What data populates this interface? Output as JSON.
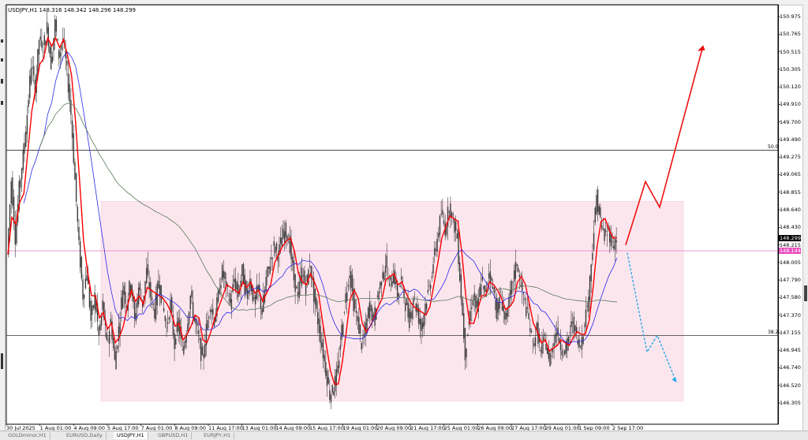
{
  "header": {
    "text": "USDJPY,H1  148.316 148.342 148.296 148.299"
  },
  "chart_data": {
    "type": "candlestick",
    "symbol": "USDJPY",
    "timeframe": "H1",
    "ylim": [
      146.25,
      151.1
    ],
    "price_ticks": [
      "150.975",
      "150.765",
      "150.515",
      "150.305",
      "150.120",
      "149.910",
      "149.700",
      "149.490",
      "149.275",
      "149.065",
      "148.855",
      "148.640",
      "148.430",
      "148.215",
      "148.005",
      "147.790",
      "147.580",
      "147.370",
      "147.155",
      "146.945",
      "146.740",
      "146.520",
      "146.305"
    ],
    "time_ticks": [
      "30 Jul 2025",
      "1 Aug 01:00",
      "4 Aug 09:00",
      "5 Aug 17:00",
      "7 Aug 01:00",
      "8 Aug 09:00",
      "11 Aug 17:00",
      "13 Aug 01:00",
      "14 Aug 09:00",
      "15 Aug 17:00",
      "19 Aug 01:00",
      "20 Aug 09:00",
      "21 Aug 17:00",
      "25 Aug 01:00",
      "26 Aug 09:00",
      "27 Aug 17:00",
      "29 Aug 01:00",
      "1 Sep 09:00",
      "2 Sep 17:00"
    ],
    "current_price": "148.299",
    "current_price_secondary": "148.144",
    "levels": [
      {
        "label": "50.0",
        "price": 149.36
      },
      {
        "label": "38.2",
        "price": 147.12
      }
    ],
    "range_box": {
      "price_high": 148.74,
      "price_low": 146.33
    },
    "price_path": [
      [
        0,
        148.1
      ],
      [
        1,
        149.0
      ],
      [
        2,
        148.3
      ],
      [
        3,
        148.9
      ],
      [
        4,
        149.3
      ],
      [
        5,
        149.8
      ],
      [
        6,
        150.4
      ],
      [
        7,
        150.1
      ],
      [
        8,
        150.7
      ],
      [
        9,
        150.6
      ],
      [
        10,
        150.85
      ],
      [
        11,
        150.4
      ],
      [
        12,
        150.9
      ],
      [
        13,
        150.5
      ],
      [
        14,
        150.7
      ],
      [
        15,
        150.3
      ],
      [
        16,
        149.8
      ],
      [
        17,
        149.0
      ],
      [
        18,
        148.2
      ],
      [
        19,
        147.6
      ],
      [
        20,
        147.9
      ],
      [
        21,
        147.3
      ],
      [
        22,
        147.6
      ],
      [
        23,
        147.1
      ],
      [
        24,
        147.5
      ],
      [
        25,
        147.0
      ],
      [
        26,
        147.3
      ],
      [
        27,
        146.8
      ],
      [
        28,
        147.2
      ],
      [
        29,
        147.7
      ],
      [
        30,
        147.5
      ],
      [
        31,
        147.8
      ],
      [
        32,
        147.3
      ],
      [
        33,
        147.7
      ],
      [
        34,
        147.5
      ],
      [
        35,
        147.9
      ],
      [
        36,
        147.6
      ],
      [
        37,
        147.4
      ],
      [
        38,
        147.8
      ],
      [
        39,
        147.5
      ],
      [
        40,
        147.2
      ],
      [
        41,
        147.5
      ],
      [
        42,
        147.0
      ],
      [
        43,
        147.3
      ],
      [
        44,
        146.9
      ],
      [
        45,
        147.2
      ],
      [
        46,
        147.6
      ],
      [
        47,
        147.3
      ],
      [
        48,
        147.1
      ],
      [
        49,
        146.8
      ],
      [
        50,
        147.2
      ],
      [
        51,
        147.5
      ],
      [
        52,
        147.3
      ],
      [
        53,
        147.6
      ],
      [
        54,
        147.9
      ],
      [
        55,
        147.7
      ],
      [
        56,
        147.5
      ],
      [
        57,
        147.8
      ],
      [
        58,
        147.6
      ],
      [
        59,
        147.9
      ],
      [
        60,
        147.6
      ],
      [
        61,
        147.8
      ],
      [
        62,
        147.5
      ],
      [
        63,
        147.7
      ],
      [
        64,
        147.4
      ],
      [
        65,
        147.8
      ],
      [
        66,
        148.0
      ],
      [
        67,
        148.2
      ],
      [
        68,
        148.1
      ],
      [
        69,
        148.3
      ],
      [
        70,
        148.4
      ],
      [
        71,
        148.2
      ],
      [
        72,
        147.8
      ],
      [
        73,
        147.6
      ],
      [
        74,
        147.9
      ],
      [
        75,
        147.7
      ],
      [
        76,
        148.0
      ],
      [
        77,
        147.6
      ],
      [
        78,
        147.3
      ],
      [
        79,
        147.0
      ],
      [
        80,
        146.7
      ],
      [
        81,
        146.4
      ],
      [
        82,
        146.5
      ],
      [
        83,
        146.7
      ],
      [
        84,
        147.2
      ],
      [
        85,
        147.6
      ],
      [
        86,
        147.9
      ],
      [
        87,
        147.5
      ],
      [
        88,
        147.3
      ],
      [
        89,
        147.0
      ],
      [
        90,
        147.2
      ],
      [
        91,
        147.5
      ],
      [
        92,
        147.3
      ],
      [
        93,
        147.6
      ],
      [
        94,
        147.8
      ],
      [
        95,
        148.0
      ],
      [
        96,
        147.7
      ],
      [
        97,
        147.9
      ],
      [
        98,
        147.6
      ],
      [
        99,
        147.8
      ],
      [
        100,
        147.5
      ],
      [
        101,
        147.3
      ],
      [
        102,
        147.6
      ],
      [
        103,
        147.4
      ],
      [
        104,
        147.2
      ],
      [
        105,
        147.5
      ],
      [
        106,
        147.7
      ],
      [
        107,
        148.0
      ],
      [
        108,
        148.3
      ],
      [
        109,
        148.6
      ],
      [
        110,
        148.4
      ],
      [
        111,
        148.7
      ],
      [
        112,
        148.5
      ],
      [
        113,
        148.3
      ],
      [
        114,
        147.6
      ],
      [
        115,
        146.9
      ],
      [
        116,
        147.3
      ],
      [
        117,
        147.6
      ],
      [
        118,
        147.4
      ],
      [
        119,
        147.8
      ],
      [
        120,
        147.6
      ],
      [
        121,
        147.9
      ],
      [
        122,
        147.7
      ],
      [
        123,
        147.4
      ],
      [
        124,
        147.6
      ],
      [
        125,
        147.3
      ],
      [
        126,
        147.5
      ],
      [
        127,
        147.8
      ],
      [
        128,
        148.0
      ],
      [
        129,
        147.7
      ],
      [
        130,
        147.5
      ],
      [
        131,
        147.3
      ],
      [
        132,
        147.0
      ],
      [
        133,
        147.2
      ],
      [
        134,
        146.9
      ],
      [
        135,
        147.1
      ],
      [
        136,
        146.8
      ],
      [
        137,
        147.0
      ],
      [
        138,
        147.2
      ],
      [
        139,
        147.0
      ],
      [
        140,
        146.9
      ],
      [
        141,
        147.1
      ],
      [
        142,
        147.3
      ],
      [
        143,
        147.1
      ],
      [
        144,
        147.0
      ],
      [
        145,
        147.3
      ],
      [
        146,
        147.6
      ],
      [
        147,
        148.2
      ],
      [
        148,
        148.8
      ],
      [
        149,
        148.5
      ],
      [
        150,
        148.3
      ],
      [
        151,
        148.4
      ],
      [
        152,
        148.2
      ],
      [
        153,
        148.3
      ]
    ],
    "fast_ma_color": "#ff0000",
    "slow_ma_color": "#2828e6",
    "long_ma_color": "#5a7a5a",
    "range_color": "#fce6ee",
    "arrow_up_color": "#ee1111",
    "arrow_down_color": "#2aa8e8"
  },
  "tabs": [
    {
      "label": "GOLDminor,H1"
    },
    {
      "label": "EURUSD,Daily"
    },
    {
      "label": "USDJPY,H1"
    },
    {
      "label": "GBPUSD,H1"
    },
    {
      "label": "EURJPY,H1"
    }
  ]
}
